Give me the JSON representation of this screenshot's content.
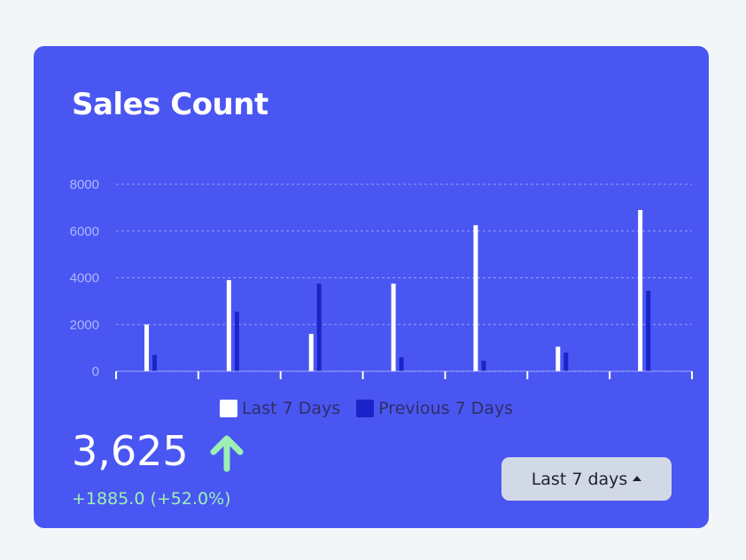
{
  "card": {
    "title": "Sales Count",
    "total_value": "3,625",
    "change_text": "+1885.0 (+52.0%)",
    "trend_icon": "arrow-up-icon",
    "range_button_label": "Last 7 days",
    "range_button_icon": "caret-up-icon"
  },
  "colors": {
    "background": "#f3f6f9",
    "card": "#4a56f2",
    "last_7_days": "#ffffff",
    "previous_7_days": "#1c24c9",
    "positive": "#9cf0b4",
    "axis_text": "#aeb7ff",
    "gridline": "#aeb7ff"
  },
  "chart_data": {
    "type": "bar",
    "title": "",
    "xlabel": "",
    "ylabel": "",
    "ylim": [
      0,
      8000
    ],
    "yticks": [
      0,
      2000,
      4000,
      6000,
      8000
    ],
    "ytick_labels": [
      "0",
      "2000",
      "4000",
      "6000",
      "8000"
    ],
    "grid": true,
    "legend_position": "bottom",
    "categories": [
      "",
      "",
      "",
      "",
      "",
      "",
      ""
    ],
    "series": [
      {
        "name": "Last 7 Days",
        "color": "#ffffff",
        "values": [
          2000,
          3900,
          1600,
          3750,
          6250,
          1050,
          6900
        ]
      },
      {
        "name": "Previous 7 Days",
        "color": "#1c24c9",
        "values": [
          700,
          2550,
          3750,
          600,
          450,
          800,
          3450
        ]
      }
    ]
  }
}
